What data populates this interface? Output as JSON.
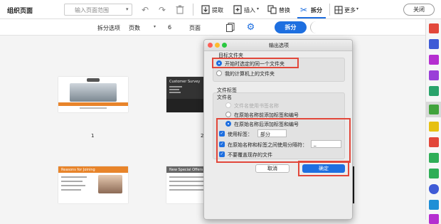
{
  "toolbar": {
    "title": "组织页面",
    "page_range_placeholder": "输入页面范围",
    "extract": "提取",
    "insert": "插入",
    "replace": "替换",
    "split": "拆分",
    "more": "更多",
    "close": "关闭"
  },
  "splitbar": {
    "options_label": "拆分选项",
    "pages_label": "页数",
    "count": "6",
    "unit": "页面",
    "split_button": "拆分"
  },
  "pages": {
    "page1_number": "1",
    "page2_number": "2"
  },
  "thumbs": {
    "survey_title": "Customer Survey",
    "reasons_title": "Reasons for Joining",
    "offers_title": "New Special Offers"
  },
  "dialog": {
    "title": "输出选项",
    "target_folder_label": "目标文件夹",
    "option_same_folder": "开始时选定的同一个文件夹",
    "option_my_computer": "我的计算机上的文件夹",
    "file_label_section": "文件标签",
    "file_name_label": "文件名",
    "name_option_bookmark": "文件名使用书签名称",
    "name_option_prefix": "在原始名称前添加标签和编号",
    "name_option_suffix": "在原始名称后添加标签和编号",
    "use_label": "使用标签：",
    "label_value": "部分",
    "use_separator": "在原始名称和标签之间使用分隔符：",
    "separator_value": "_",
    "no_overwrite": "不要覆盖现存的文件",
    "cancel": "取消",
    "ok": "确定"
  },
  "colors": {
    "accent": "#1e6fe0",
    "highlight": "#e2473a"
  }
}
